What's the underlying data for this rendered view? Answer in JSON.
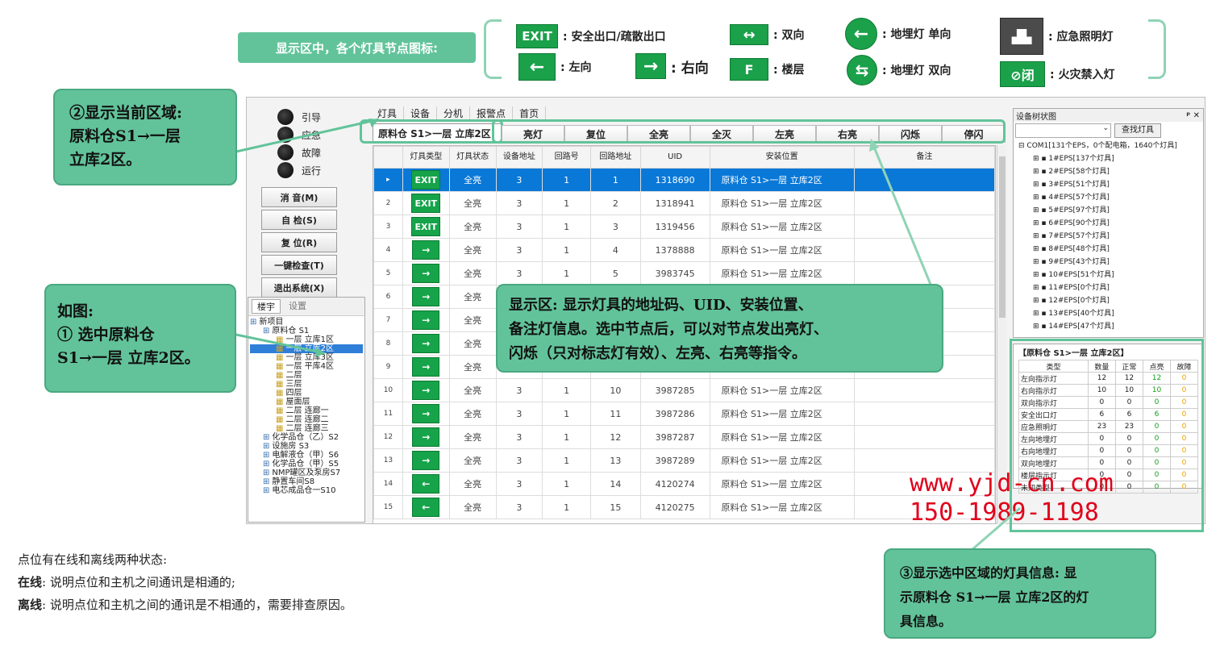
{
  "legend": {
    "title": "显示区中，各个灯具节点图标:",
    "items": [
      {
        "icon": "EXIT",
        "label": ": 安全出口/疏散出口"
      },
      {
        "icon": "↔",
        "label": ": 双向"
      },
      {
        "icon": "←",
        "label": ": 地埋灯 单向"
      },
      {
        "icon": "▟▙",
        "label": ": 应急照明灯"
      },
      {
        "icon": "←",
        "label": ": 左向"
      },
      {
        "icon": "→",
        "label": ": 右向"
      },
      {
        "icon": "F",
        "label": ": 楼层"
      },
      {
        "icon": "⇆",
        "label": ": 地埋灯 双向"
      },
      {
        "icon": "⊘闭",
        "label": ": 火灾禁入灯"
      }
    ]
  },
  "callouts": {
    "area": "②显示当前区域:\n原料仓S1→一层\n立库2区。",
    "select": "如图:\n① 选中原料仓\nS1→一层 立库2区。",
    "display": "显示区: 显示灯具的地址码、UID、安装位置、\n备注灯信息。选中节点后，可以对节点发出亮灯、\n闪烁（只对标志灯有效）、左亮、右亮等指令。",
    "info": "③显示选中区域的灯具信息: 显\n示原料仓 S1→一层 立库2区的灯\n具信息。"
  },
  "left_panel": {
    "status": [
      "引导",
      "应急",
      "故障",
      "运行"
    ],
    "buttons": [
      "消 音(M)",
      "自 检(S)",
      "复 位(R)",
      "一键检查(T)",
      "退出系统(X)"
    ],
    "tree_tabs": [
      "楼宇",
      "设置"
    ],
    "tree": [
      {
        "label": "新项目",
        "level": 0
      },
      {
        "label": "原料仓 S1",
        "level": 1
      },
      {
        "label": "一层 立库1区",
        "level": 2
      },
      {
        "label": "一层 立库2区",
        "level": 2,
        "selected": true
      },
      {
        "label": "一层 立库3区",
        "level": 2
      },
      {
        "label": "一层 平库4区",
        "level": 2
      },
      {
        "label": "二层",
        "level": 2
      },
      {
        "label": "三层",
        "level": 2
      },
      {
        "label": "四层",
        "level": 2
      },
      {
        "label": "屋面层",
        "level": 2
      },
      {
        "label": "二层 连廊一",
        "level": 2
      },
      {
        "label": "二层 连廊二",
        "level": 2
      },
      {
        "label": "二层 连廊三",
        "level": 2
      },
      {
        "label": "化学品仓（乙）S2",
        "level": 1
      },
      {
        "label": "设施房 S3",
        "level": 1
      },
      {
        "label": "电解液仓（甲）S6",
        "level": 1
      },
      {
        "label": "化学品仓（甲）S5",
        "level": 1
      },
      {
        "label": "NMP罐区及泵房S7",
        "level": 1
      },
      {
        "label": "静置车间S8",
        "level": 1
      },
      {
        "label": "电芯成品仓一S10",
        "level": 1
      }
    ]
  },
  "main": {
    "tabs": [
      "灯具",
      "设备",
      "分机",
      "报警点",
      "首页"
    ],
    "area_label": "原料仓 S1>一层 立库2区",
    "commands": [
      "亮灯",
      "复位",
      "全亮",
      "全灭",
      "左亮",
      "右亮",
      "闪烁",
      "停闪"
    ],
    "columns": [
      "灯具类型",
      "灯具状态",
      "设备地址",
      "回路号",
      "回路地址",
      "UID",
      "安装位置",
      "备注"
    ],
    "rows": [
      {
        "n": "",
        "icon": "EXIT",
        "state": "全亮",
        "dev": "3",
        "loop": "1",
        "addr": "1",
        "uid": "1318690",
        "loc": "原料仓 S1>一层 立库2区"
      },
      {
        "n": "2",
        "icon": "EXIT",
        "state": "全亮",
        "dev": "3",
        "loop": "1",
        "addr": "2",
        "uid": "1318941",
        "loc": "原料仓 S1>一层 立库2区"
      },
      {
        "n": "3",
        "icon": "EXIT",
        "state": "全亮",
        "dev": "3",
        "loop": "1",
        "addr": "3",
        "uid": "1319456",
        "loc": "原料仓 S1>一层 立库2区"
      },
      {
        "n": "4",
        "icon": "→",
        "state": "全亮",
        "dev": "3",
        "loop": "1",
        "addr": "4",
        "uid": "1378888",
        "loc": "原料仓 S1>一层 立库2区"
      },
      {
        "n": "5",
        "icon": "→",
        "state": "全亮",
        "dev": "3",
        "loop": "1",
        "addr": "5",
        "uid": "3983745",
        "loc": "原料仓 S1>一层 立库2区"
      },
      {
        "n": "6",
        "icon": "→",
        "state": "全亮",
        "dev": "",
        "loop": "",
        "addr": "",
        "uid": "",
        "loc": ""
      },
      {
        "n": "7",
        "icon": "→",
        "state": "全亮",
        "dev": "",
        "loop": "",
        "addr": "",
        "uid": "",
        "loc": ""
      },
      {
        "n": "8",
        "icon": "→",
        "state": "全亮",
        "dev": "",
        "loop": "",
        "addr": "",
        "uid": "",
        "loc": ""
      },
      {
        "n": "9",
        "icon": "→",
        "state": "全亮",
        "dev": "",
        "loop": "",
        "addr": "",
        "uid": "",
        "loc": ""
      },
      {
        "n": "10",
        "icon": "→",
        "state": "全亮",
        "dev": "3",
        "loop": "1",
        "addr": "10",
        "uid": "3987285",
        "loc": "原料仓 S1>一层 立库2区"
      },
      {
        "n": "11",
        "icon": "→",
        "state": "全亮",
        "dev": "3",
        "loop": "1",
        "addr": "11",
        "uid": "3987286",
        "loc": "原料仓 S1>一层 立库2区"
      },
      {
        "n": "12",
        "icon": "→",
        "state": "全亮",
        "dev": "3",
        "loop": "1",
        "addr": "12",
        "uid": "3987287",
        "loc": "原料仓 S1>一层 立库2区"
      },
      {
        "n": "13",
        "icon": "→",
        "state": "全亮",
        "dev": "3",
        "loop": "1",
        "addr": "13",
        "uid": "3987289",
        "loc": "原料仓 S1>一层 立库2区"
      },
      {
        "n": "14",
        "icon": "←",
        "state": "全亮",
        "dev": "3",
        "loop": "1",
        "addr": "14",
        "uid": "4120274",
        "loc": "原料仓 S1>一层 立库2区"
      },
      {
        "n": "15",
        "icon": "←",
        "state": "全亮",
        "dev": "3",
        "loop": "1",
        "addr": "15",
        "uid": "4120275",
        "loc": "原料仓 S1>一层 立库2区"
      }
    ]
  },
  "right_panel": {
    "title": "设备树状图",
    "find_button": "查找灯具",
    "root": "COM1[131个EPS，0个配电箱，1640个灯具]",
    "items": [
      "1#EPS[137个灯具]",
      "2#EPS[58个灯具]",
      "3#EPS[51个灯具]",
      "4#EPS[57个灯具]",
      "5#EPS[97个灯具]",
      "6#EPS[90个灯具]",
      "7#EPS[57个灯具]",
      "8#EPS[48个灯具]",
      "9#EPS[43个灯具]",
      "10#EPS[51个灯具]",
      "11#EPS[0个灯具]",
      "12#EPS[0个灯具]",
      "13#EPS[40个灯具]",
      "14#EPS[47个灯具]"
    ],
    "stats_title": "【原料仓 S1>一层 立库2区】",
    "stats_headers": [
      "类型",
      "数量",
      "正常",
      "点亮",
      "故障"
    ],
    "stats": [
      [
        "左向指示灯",
        "12",
        "12",
        "12",
        "0"
      ],
      [
        "右向指示灯",
        "10",
        "10",
        "10",
        "0"
      ],
      [
        "双向指示灯",
        "0",
        "0",
        "0",
        "0"
      ],
      [
        "安全出口灯",
        "6",
        "6",
        "6",
        "0"
      ],
      [
        "应急照明灯",
        "23",
        "23",
        "0",
        "0"
      ],
      [
        "左向地埋灯",
        "0",
        "0",
        "0",
        "0"
      ],
      [
        "右向地埋灯",
        "0",
        "0",
        "0",
        "0"
      ],
      [
        "双向地埋灯",
        "0",
        "0",
        "0",
        "0"
      ],
      [
        "楼层指示灯",
        "0",
        "0",
        "0",
        "0"
      ],
      [
        "未知类型",
        "0",
        "0",
        "0",
        "0"
      ]
    ]
  },
  "watermark": {
    "site": "www.yjd-cn.com",
    "phone": "150-1989-1198"
  },
  "notes": {
    "line1": "点位有在线和离线两种状态:",
    "online_key": "在线",
    "online_text": ": 说明点位和主机之间通讯是相通的;",
    "offline_key": "离线",
    "offline_text": ": 说明点位和主机之间的通讯是不相通的，需要排查原因。"
  },
  "colors": {
    "accent": "#62c39a",
    "sign_green": "#16a34a",
    "selected_row": "#0a78d7",
    "watermark": "#e0001a"
  }
}
